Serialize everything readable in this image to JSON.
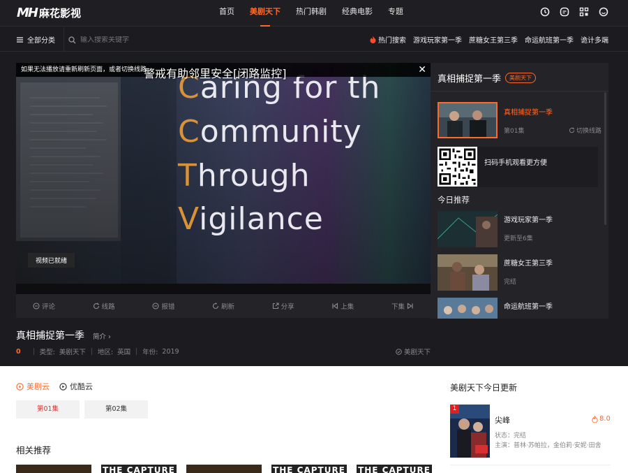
{
  "brand": {
    "logo_mark": "MH",
    "logo_text": "麻花影视",
    "accent": "#ff6a2c"
  },
  "nav": {
    "items": [
      {
        "label": "首页",
        "active": false
      },
      {
        "label": "美剧天下",
        "active": true
      },
      {
        "label": "热门韩剧",
        "active": false
      },
      {
        "label": "经典电影",
        "active": false
      },
      {
        "label": "专题",
        "active": false
      }
    ],
    "icons": [
      "clock-icon",
      "message-icon",
      "qrcode-icon",
      "user-icon"
    ]
  },
  "subbar": {
    "category_label": "全部分类",
    "search_placeholder": "输入搜索关键字",
    "hot_title": "热门搜索",
    "hot_items": [
      "游戏玩家第一季",
      "蔗糖女王第三季",
      "命运航班第一季",
      "诡计多端"
    ]
  },
  "player": {
    "notice": "如果无法播放请重新刷新页面，或者切换线路",
    "subtitle": "警戒有助邻里安全[闭路监控]",
    "video_lines": [
      {
        "cap": "C",
        "rest": "aring for th"
      },
      {
        "cap": "C",
        "rest": "ommunity"
      },
      {
        "cap": "T",
        "rest": "hrough"
      },
      {
        "cap": "V",
        "rest": "igilance"
      }
    ],
    "ready_badge": "视频已就绪",
    "controls": [
      {
        "label": "评论",
        "icon": "comment-icon"
      },
      {
        "label": "线路",
        "icon": "refresh-icon"
      },
      {
        "label": "报错",
        "icon": "minus-circle-icon"
      },
      {
        "label": "刷新",
        "icon": "reload-icon"
      },
      {
        "label": "分享",
        "icon": "share-icon"
      },
      {
        "label": "上集",
        "icon": "prev-icon"
      },
      {
        "label": "下集",
        "icon": "next-icon"
      }
    ]
  },
  "info": {
    "title": "真相捕捉第一季",
    "intro_label": "简介",
    "score": "0",
    "type_label": "类型:",
    "type_value": "美剧天下",
    "region_label": "地区:",
    "region_value": "英国",
    "year_label": "年份:",
    "year_value": "2019",
    "tag": "美剧天下"
  },
  "side": {
    "title": "真相捕捉第一季",
    "tag": "美剧天下",
    "current": {
      "name": "真相捕捉第一季",
      "episode": "第01集",
      "switch_label": "切换线路"
    },
    "qr_text": "扫码手机观看更方便",
    "today_title": "今日推荐",
    "recommendations": [
      {
        "name": "游戏玩家第一季",
        "status": "更新至6集"
      },
      {
        "name": "蔗糖女王第三季",
        "status": "完结"
      },
      {
        "name": "命运航班第一季",
        "status": ""
      }
    ]
  },
  "lower": {
    "sources": [
      {
        "label": "美剧云",
        "active": true
      },
      {
        "label": "优酷云",
        "active": false
      }
    ],
    "episodes": [
      {
        "label": "第01集",
        "active": true
      },
      {
        "label": "第02集",
        "active": false
      }
    ],
    "related_title": "相关推荐",
    "related_cards": [
      "",
      "THE CAPTURE",
      "",
      "THE CAPTURE",
      "THE CAPTURE"
    ],
    "today_update_title": "美剧天下今日更新",
    "update_item": {
      "rank": "1",
      "name": "尖峰",
      "score": "8.0",
      "status": "状态：完结",
      "cast": "主演：普林·苏帕拉，金伯莉·安妮·田舍"
    }
  }
}
